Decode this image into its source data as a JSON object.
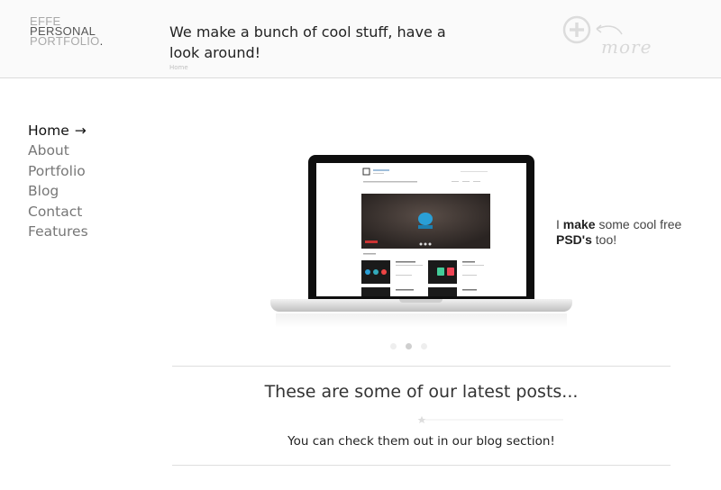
{
  "logo": {
    "line1": "EFFE",
    "line2": "PERSONAL",
    "line3": "PORTFOLIO",
    "dot": "."
  },
  "header": {
    "tagline": "We make a bunch of cool stuff, have a look around!",
    "breadcrumb": "Home",
    "more_label": "more",
    "more_icon": "plus-circle-icon"
  },
  "nav": {
    "items": [
      {
        "label": "Home",
        "active": true,
        "suffix": "→"
      },
      {
        "label": "About"
      },
      {
        "label": "Portfolio"
      },
      {
        "label": "Blog"
      },
      {
        "label": "Contact"
      },
      {
        "label": "Features"
      }
    ]
  },
  "hero": {
    "promo_pre": "I ",
    "promo_bold1": "make",
    "promo_mid": " some cool free ",
    "promo_bold2": "PSD's",
    "promo_post": " too!",
    "slider_dots": 3,
    "active_dot": 2
  },
  "posts": {
    "title": "These are some of our latest posts...",
    "subtitle": "You can check them out in our blog section!"
  },
  "colors": {
    "accent": "#111111",
    "muted": "#777777",
    "divider": "#dedede"
  }
}
